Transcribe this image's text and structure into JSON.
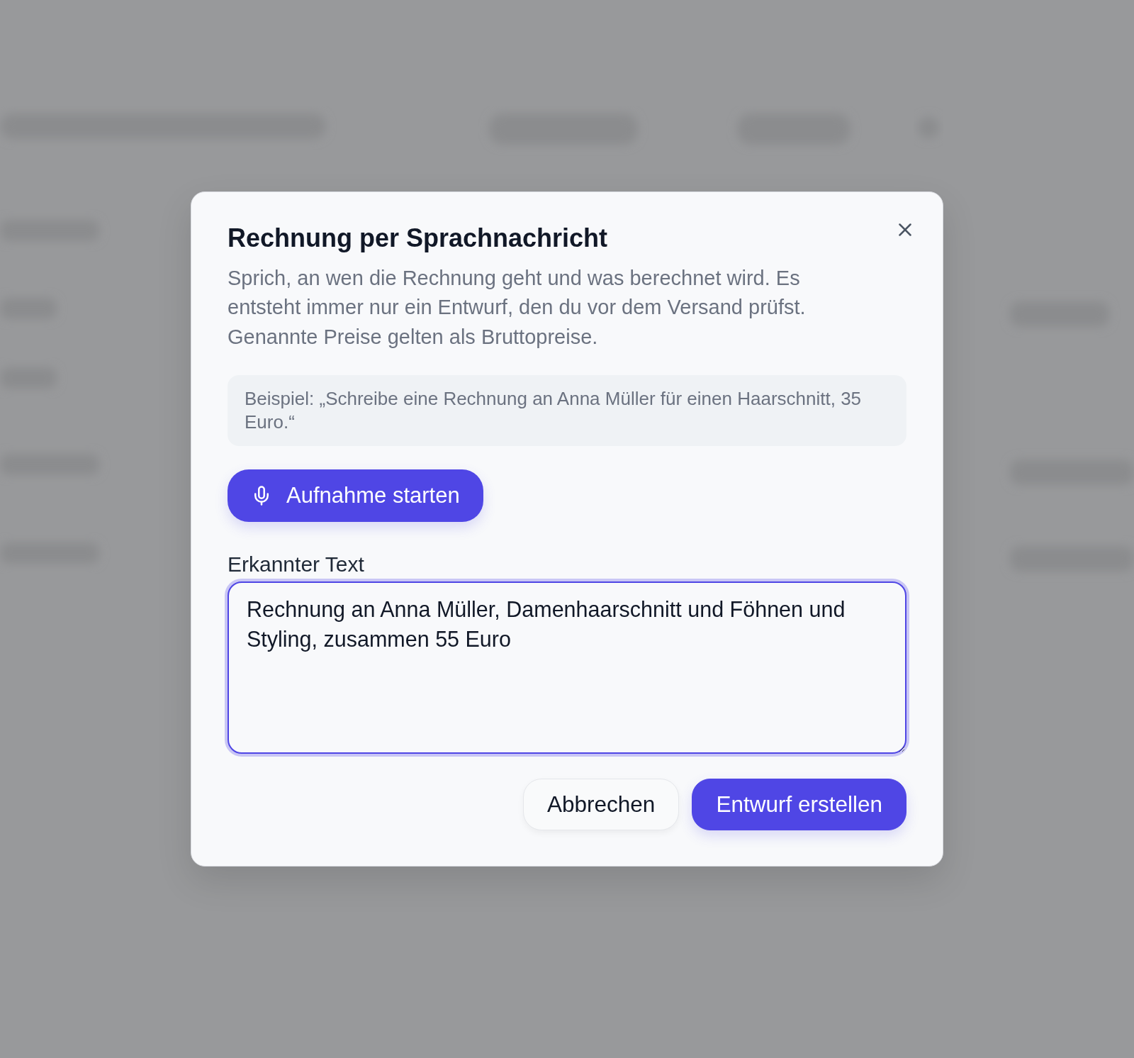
{
  "dialog": {
    "title": "Rechnung per Sprachnachricht",
    "description": "Sprich, an wen die Rechnung geht und was berechnet wird. Es entsteht immer nur ein Entwurf, den du vor dem Versand prüfst. Genannte Preise gelten als Bruttopreise.",
    "example": "Beispiel: „Schreibe eine Rechnung an Anna Müller für einen Haarschnitt, 35 Euro.“",
    "record_button": {
      "label": "Aufnahme starten"
    },
    "recognized_text": {
      "label": "Erkannter Text",
      "value": "Rechnung an Anna Müller, Damenhaarschnitt und Föhnen und Styling, zusammen 55 Euro",
      "focused": true
    },
    "buttons": [
      {
        "label": "Abbrechen",
        "kind": "secondary"
      },
      {
        "label": "Entwurf erstellen",
        "kind": "primary"
      }
    ]
  }
}
